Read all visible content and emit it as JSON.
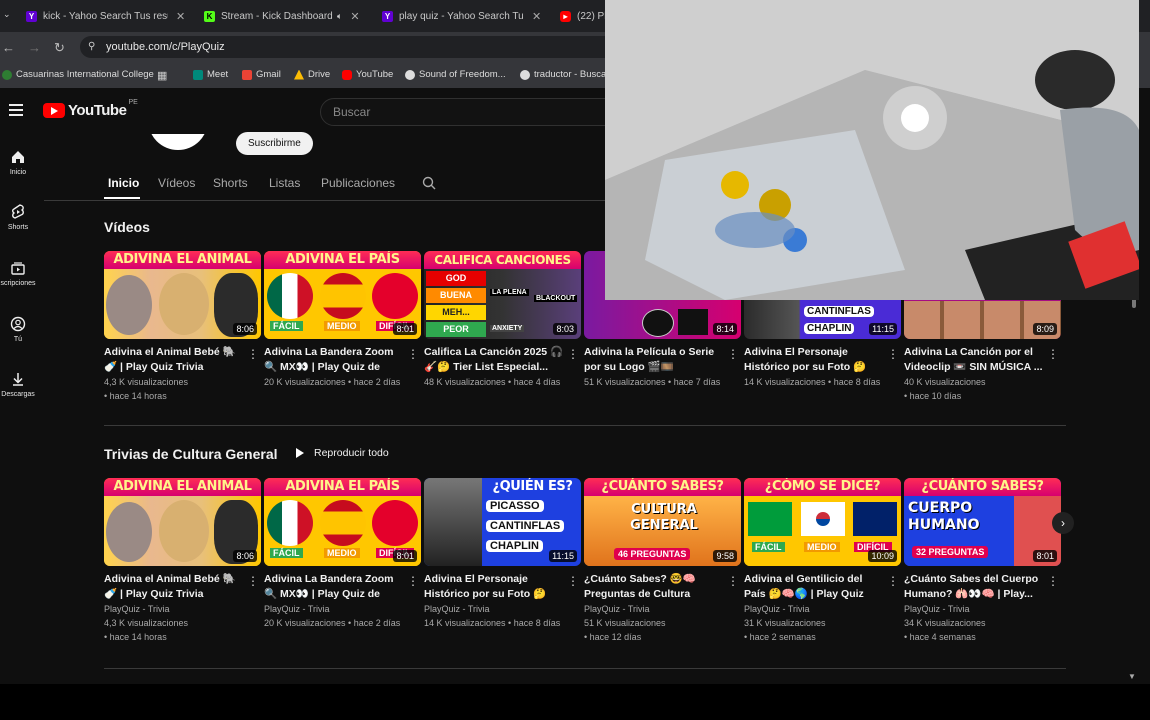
{
  "browser": {
    "tabs": [
      {
        "label": "kick - Yahoo Search Tus resulta",
        "icon": "yahoo-icon",
        "color": "#6001d2"
      },
      {
        "label": "Stream - Kick Dashboard",
        "icon": "kick-icon",
        "color": "#53fc18"
      },
      {
        "label": "play quiz - Yahoo Search Tus re",
        "icon": "yahoo-icon",
        "color": "#6001d2"
      },
      {
        "label": "(22) Pla",
        "icon": "youtube-icon",
        "color": "#ff0000"
      }
    ],
    "url": "youtube.com/c/PlayQuiz",
    "bookmarks": [
      {
        "label": "Casuarinas International College",
        "color": "#2e7d32"
      },
      {
        "label": "",
        "color": "#888888"
      },
      {
        "label": "Meet",
        "color": "#00897b"
      },
      {
        "label": "Gmail",
        "color": "#ea4335"
      },
      {
        "label": "Drive",
        "color": "#fbbc04"
      },
      {
        "label": "YouTube",
        "color": "#ff0000"
      },
      {
        "label": "Sound of Freedom...",
        "color": "#dddddd"
      },
      {
        "label": "traductor - Busca",
        "color": "#dddddd"
      }
    ]
  },
  "youtube": {
    "logo_text": "YouTube",
    "region": "PE",
    "search_placeholder": "Buscar",
    "sidebar": [
      {
        "label": "Inicio",
        "icon": "home-icon"
      },
      {
        "label": "Shorts",
        "icon": "shorts-icon"
      },
      {
        "label": "scripciones",
        "icon": "subscriptions-icon"
      },
      {
        "label": "Tú",
        "icon": "you-icon"
      },
      {
        "label": "Descargas",
        "icon": "downloads-icon"
      }
    ],
    "subscribe_label": "Suscribirme",
    "channel_tabs": [
      "Inicio",
      "Vídeos",
      "Shorts",
      "Listas",
      "Publicaciones"
    ]
  },
  "videos_section": {
    "title": "Vídeos",
    "cards": [
      {
        "banner": "ADIVINA EL ANIMAL",
        "duration": "8:06",
        "title": "Adivina el Animal Bebé 🐘🍼 | Play Quiz Trivia",
        "meta1": "4,3 K visualizaciones",
        "meta2": "• hace 14 horas"
      },
      {
        "banner": "ADIVINA EL PAÍS",
        "duration": "8:01",
        "title": "Adivina La Bandera Zoom 🔍 MX👀 | Play Quiz de Países",
        "meta1": "20 K visualizaciones • hace 2 días",
        "meta2": ""
      },
      {
        "banner": "CALIFICA CANCIONES",
        "duration": "8:03",
        "title": "Califica La Canción 2025 🎧🎸🤔 Tier List Especial...",
        "meta1": "48 K visualizaciones • hace 4 días",
        "meta2": ""
      },
      {
        "banner": "",
        "duration": "8:14",
        "title": "Adivina la Película o Serie por su Logo 🎬🎞️ ¿Cuántas...",
        "meta1": "51 K visualizaciones • hace 7 días",
        "meta2": ""
      },
      {
        "banner": "",
        "duration": "11:15",
        "title": "Adivina El Personaje Histórico por su Foto 🤔👀...",
        "meta1": "14 K visualizaciones • hace 8 días",
        "meta2": ""
      },
      {
        "banner": "",
        "duration": "8:09",
        "title": "Adivina La Canción por el Videoclip 📼 SIN MÚSICA ...",
        "meta1": "40 K visualizaciones",
        "meta2": "• hace 10 días"
      }
    ]
  },
  "trivia_section": {
    "title": "Trivias de Cultura General",
    "play_all": "Reproducir todo",
    "cards": [
      {
        "banner": "ADIVINA EL ANIMAL",
        "duration": "8:06",
        "title": "Adivina el Animal Bebé 🐘🍼 | Play Quiz Trivia",
        "channel": "PlayQuiz - Trivia",
        "meta1": "4,3 K visualizaciones",
        "meta2": "• hace 14 horas"
      },
      {
        "banner": "ADIVINA EL PAÍS",
        "duration": "8:01",
        "title": "Adivina La Bandera Zoom 🔍 MX👀 | Play Quiz de Países",
        "channel": "PlayQuiz - Trivia",
        "meta1": "20 K visualizaciones • hace 2 días",
        "meta2": ""
      },
      {
        "banner": "¿QUIÉN ES?",
        "duration": "11:15",
        "title": "Adivina El Personaje Histórico por su Foto 🤔👀...",
        "channel": "PlayQuiz - Trivia",
        "meta1": "14 K visualizaciones • hace 8 días",
        "meta2": ""
      },
      {
        "banner": "¿CUÁNTO SABES?",
        "duration": "9:58",
        "title": "¿Cuánto Sabes? 🤓🧠 Preguntas de Cultura gener...",
        "channel": "PlayQuiz - Trivia",
        "meta1": "51 K visualizaciones",
        "meta2": "• hace 12 días"
      },
      {
        "banner": "¿CÓMO SE DICE?",
        "duration": "10:09",
        "title": "Adivina el Gentilicio del País 🤔🧠🌎 | Play Quiz de...",
        "channel": "PlayQuiz - Trivia",
        "meta1": "31 K visualizaciones",
        "meta2": "• hace 2 semanas"
      },
      {
        "banner": "¿CUÁNTO SABES?",
        "duration": "8:01",
        "title": "¿Cuánto Sabes del Cuerpo Humano? 🫁👀🧠 | Play...",
        "channel": "PlayQuiz - Trivia",
        "meta1": "34 K visualizaciones",
        "meta2": "• hace 4 semanas"
      }
    ],
    "thumb_texts": [
      "FÁCIL",
      "MEDIO",
      "DIFÍCIL",
      "GOD",
      "BUENA",
      "MEH...",
      "PEOR",
      "LA PLENA",
      "BLACKOUT",
      "ANXIETY",
      "CANTINFLAS",
      "CHAPLIN",
      "PICASSO",
      "CULTURA GENERAL",
      "46 PREGUNTAS",
      "CUERPO HUMANO",
      "32 PREGUNTAS"
    ]
  },
  "colors": {
    "background": "#0f0f0f",
    "banner": "#e0005f",
    "youtube_red": "#ff0000"
  }
}
